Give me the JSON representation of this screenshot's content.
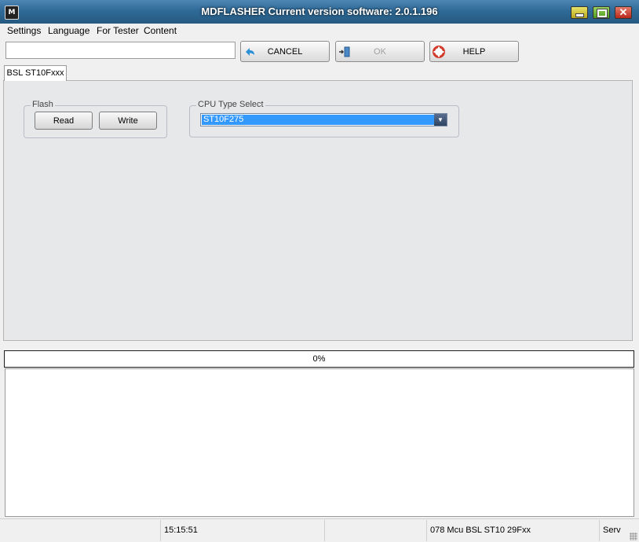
{
  "window": {
    "title": "MDFLASHER  Current version software: 2.0.1.196",
    "icon": "app-logo-icon"
  },
  "menu": {
    "items": [
      "Settings",
      "Language",
      "For Tester",
      "Content"
    ]
  },
  "toolbar": {
    "input_value": "",
    "cancel_label": "CANCEL",
    "ok_label": "OK",
    "help_label": "HELP"
  },
  "tabs": [
    {
      "label": "BSL ST10Fxxx",
      "selected": true
    }
  ],
  "flash_group": {
    "title": "Flash",
    "read_label": "Read",
    "write_label": "Write"
  },
  "cpu_group": {
    "title": "CPU Type Select",
    "selected": "ST10F275"
  },
  "progress": {
    "value": 0,
    "text": "0%"
  },
  "log": {
    "text": ""
  },
  "statusbar": {
    "cells": [
      "",
      "15:15:51",
      "",
      "078 Mcu BSL ST10 29Fxx",
      "Serv"
    ]
  },
  "colors": {
    "titlebar": "#2f6a98",
    "selection": "#3399ff"
  }
}
